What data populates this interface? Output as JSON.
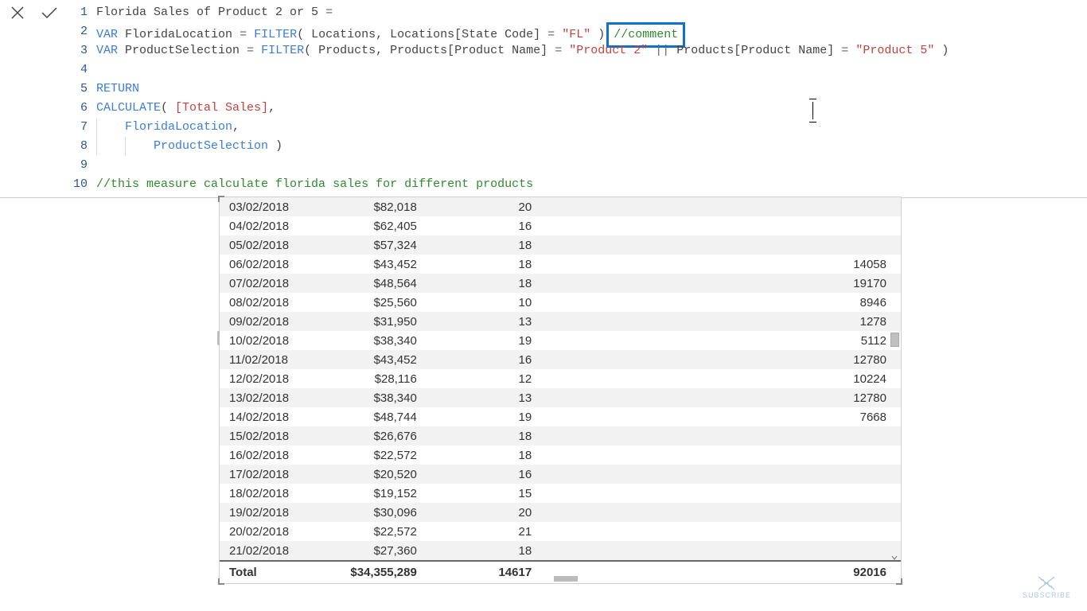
{
  "formula": {
    "line_numbers": [
      "1",
      "2",
      "3",
      "4",
      "5",
      "6",
      "7",
      "8",
      "9",
      "10"
    ],
    "l1_name": "Florida Sales of Product 2 or 5",
    "l1_eq": " = ",
    "l2_var": "VAR",
    "l2_name": " FloridaLocation ",
    "l2_eq": "= ",
    "l2_fn": "FILTER",
    "l2_p1": "( ",
    "l2_tbl": "Locations",
    "l2_comma": ", ",
    "l2_col": "Locations[State Code]",
    "l2_eq2": " = ",
    "l2_str": "\"FL\"",
    "l2_p2": " )",
    "l2_comment": "//comment",
    "l3_var": "VAR",
    "l3_name": " ProductSelection ",
    "l3_eq": "= ",
    "l3_fn": "FILTER",
    "l3_p1": "( ",
    "l3_tbl": "Products",
    "l3_comma": ", ",
    "l3_col1": "Products[Product Name]",
    "l3_eq2": " = ",
    "l3_str1": "\"Product 2\"",
    "l3_or": " || ",
    "l3_col2": "Products[Product Name]",
    "l3_eq3": " = ",
    "l3_str2": "\"Product 5\"",
    "l3_p2": " )",
    "l5_return": "RETURN",
    "l6_fn": "CALCULATE",
    "l6_p1": "( ",
    "l6_measure": "[Total Sales]",
    "l6_comma": ",",
    "l7_name": "FloridaLocation",
    "l7_comma": ",",
    "l8_name": "ProductSelection",
    "l8_p2": " )",
    "l10_comment": "//this measure calculate florida sales for different products"
  },
  "table": {
    "rows": [
      {
        "date": "03/02/2018",
        "amount": "$82,018",
        "qty": "20",
        "val": ""
      },
      {
        "date": "04/02/2018",
        "amount": "$62,405",
        "qty": "16",
        "val": ""
      },
      {
        "date": "05/02/2018",
        "amount": "$57,324",
        "qty": "18",
        "val": ""
      },
      {
        "date": "06/02/2018",
        "amount": "$43,452",
        "qty": "18",
        "val": "14058"
      },
      {
        "date": "07/02/2018",
        "amount": "$48,564",
        "qty": "18",
        "val": "19170"
      },
      {
        "date": "08/02/2018",
        "amount": "$25,560",
        "qty": "10",
        "val": "8946"
      },
      {
        "date": "09/02/2018",
        "amount": "$31,950",
        "qty": "13",
        "val": "1278"
      },
      {
        "date": "10/02/2018",
        "amount": "$38,340",
        "qty": "19",
        "val": "5112"
      },
      {
        "date": "11/02/2018",
        "amount": "$43,452",
        "qty": "16",
        "val": "12780"
      },
      {
        "date": "12/02/2018",
        "amount": "$28,116",
        "qty": "12",
        "val": "10224"
      },
      {
        "date": "13/02/2018",
        "amount": "$38,340",
        "qty": "13",
        "val": "12780"
      },
      {
        "date": "14/02/2018",
        "amount": "$48,744",
        "qty": "19",
        "val": "7668"
      },
      {
        "date": "15/02/2018",
        "amount": "$26,676",
        "qty": "18",
        "val": ""
      },
      {
        "date": "16/02/2018",
        "amount": "$22,572",
        "qty": "18",
        "val": ""
      },
      {
        "date": "17/02/2018",
        "amount": "$20,520",
        "qty": "16",
        "val": ""
      },
      {
        "date": "18/02/2018",
        "amount": "$19,152",
        "qty": "15",
        "val": ""
      },
      {
        "date": "19/02/2018",
        "amount": "$30,096",
        "qty": "20",
        "val": ""
      },
      {
        "date": "20/02/2018",
        "amount": "$22,572",
        "qty": "21",
        "val": ""
      },
      {
        "date": "21/02/2018",
        "amount": "$27,360",
        "qty": "18",
        "val": ""
      }
    ],
    "total": {
      "label": "Total",
      "amount": "$34,355,289",
      "qty": "14617",
      "val": "92016"
    }
  },
  "footer": {
    "subscribe": "SUBSCRIBE"
  }
}
